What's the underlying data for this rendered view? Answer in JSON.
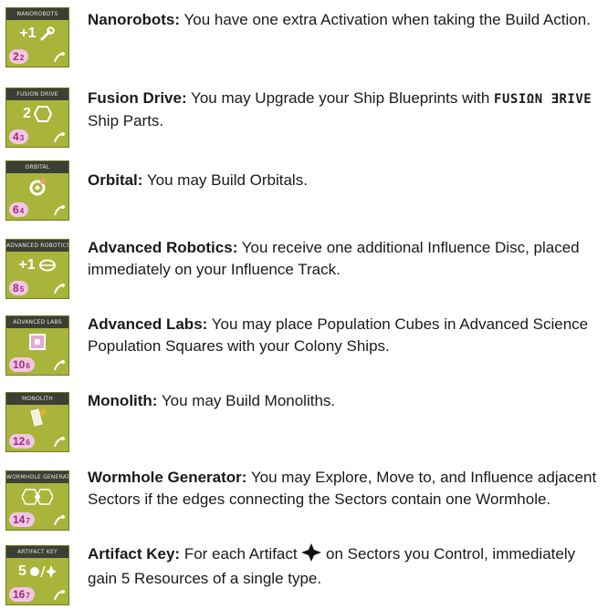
{
  "colors": {
    "tile": "#a8b43a",
    "header": "#3c3f34",
    "cost_badge": "#f2c6e4",
    "cost_text": "#9a2c7a"
  },
  "techs": [
    {
      "tile_label": "NANOROBOTS",
      "effect_text": "+1",
      "effect_icon": "wrench-icon",
      "cost": "2",
      "min_cost": "2",
      "name": "Nanorobots:",
      "text": " You have one extra Activation when taking the Build Action."
    },
    {
      "tile_label": "FUSION DRIVE",
      "effect_text": "2",
      "effect_icon": "hexagon-icon",
      "cost": "4",
      "min_cost": "3",
      "name": "Fusion Drive:",
      "text_before": " You may Upgrade your Ship Blueprints with ",
      "tag": "FUSIΩN ƎRIVE",
      "text_after": " Ship Parts."
    },
    {
      "tile_label": "ORBITAL",
      "effect_text": "",
      "effect_icon": "orbital-icon",
      "cost": "6",
      "min_cost": "4",
      "name": "Orbital:",
      "text": " You may Build Orbitals."
    },
    {
      "tile_label": "ADVANCED ROBOTICS",
      "effect_text": "+1",
      "effect_icon": "influence-disc-icon",
      "cost": "8",
      "min_cost": "5",
      "name": "Advanced Robotics:",
      "text": " You receive one additional Influence Disc, placed immediately on your Influence Track."
    },
    {
      "tile_label": "ADVANCED LABS",
      "effect_text": "",
      "effect_icon": "population-square-icon",
      "cost": "10",
      "min_cost": "6",
      "name": "Advanced Labs:",
      "text": " You may place Population Cubes in Advanced Science Population Squares with your Colony Ships."
    },
    {
      "tile_label": "MONOLITH",
      "effect_text": "",
      "effect_icon": "monolith-icon",
      "cost": "12",
      "min_cost": "6",
      "name": "Monolith:",
      "text": " You may Build Monoliths."
    },
    {
      "tile_label": "WORMHOLE GENERATOR",
      "effect_text": "",
      "effect_icon": "wormhole-icon",
      "cost": "14",
      "min_cost": "7",
      "name": "Wormhole Generator:",
      "text": " You may Explore, Move to, and Influence adjacent Sectors if the edges connecting the Sectors contain one Wormhole."
    },
    {
      "tile_label": "ARTIFACT KEY",
      "effect_text": "5",
      "effect_icon": "artifact-icon",
      "cost": "16",
      "min_cost": "7",
      "name": "Artifact Key:",
      "text_before": " For each Artifact ",
      "text_after": " on Sectors you Control, immediately gain 5 Resources of a single type."
    }
  ]
}
